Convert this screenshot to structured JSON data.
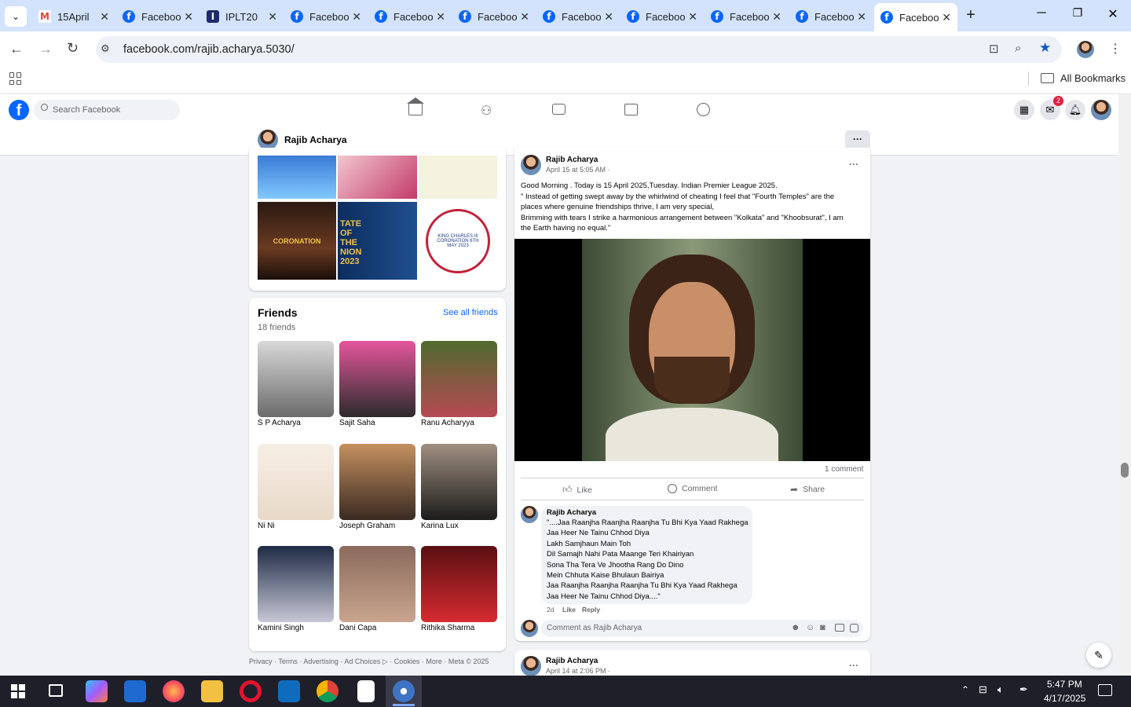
{
  "browser": {
    "tabs": [
      {
        "title": "15April",
        "icon": "gmail-icon"
      },
      {
        "title": "Facebook",
        "icon": "facebook-icon"
      },
      {
        "title": "IPLT20",
        "icon": "iplt20-icon"
      },
      {
        "title": "Facebook",
        "icon": "facebook-icon"
      },
      {
        "title": "Facebook",
        "icon": "facebook-icon"
      },
      {
        "title": "Facebook",
        "icon": "facebook-icon"
      },
      {
        "title": "Facebook",
        "icon": "facebook-icon"
      },
      {
        "title": "Facebook",
        "icon": "facebook-icon"
      },
      {
        "title": "Facebook",
        "icon": "facebook-icon"
      },
      {
        "title": "Facebook",
        "icon": "facebook-icon"
      },
      {
        "title": "Facebook",
        "icon": "facebook-icon",
        "active": true
      }
    ],
    "url": "facebook.com/rajib.acharya.5030/",
    "all_bookmarks": "All Bookmarks"
  },
  "fb": {
    "search_placeholder": "Search Facebook",
    "messenger_badge": "2",
    "profile_name": "Rajib Acharya",
    "more_button": "···"
  },
  "photos": {
    "tiles": [
      "CORONATION",
      "TATE OF THE NION 2023",
      "KING CHARLES III CORONATION 6TH MAY 2023"
    ]
  },
  "friends": {
    "title": "Friends",
    "count": "18 friends",
    "see_all": "See all friends",
    "list": [
      {
        "name": "S P Acharya"
      },
      {
        "name": "Sajit Saha"
      },
      {
        "name": "Ranu Acharyya"
      },
      {
        "name": "Ni Ni"
      },
      {
        "name": "Joseph Graham"
      },
      {
        "name": "Karina Lux"
      },
      {
        "name": "Kamini Singh"
      },
      {
        "name": "Dani Capa"
      },
      {
        "name": "Rithika Sharma"
      }
    ]
  },
  "footer": "Privacy · Terms · Advertising · Ad Choices ▷ · Cookies · More · Meta © 2025",
  "post": {
    "author": "Rajib Acharya",
    "time": "April 15 at 5:05 AM ·",
    "lines": [
      "Good Morning . Today is 15 April 2025,Tuesday. Indian Premier League 2025.",
      "\" Instead of getting swept away by the whirlwind of cheating I feel that \"Fourth Temples\" are the",
      "places where genuine friendships thrive, I am very special,",
      "Brimming with tears I strike a harmonious arrangement between \"Kolkata\" and \"Khoobsurat\", I am",
      "the Earth having no equal.\""
    ],
    "comments_count": "1 comment",
    "like": "Like",
    "comment": "Comment",
    "share": "Share",
    "reply": {
      "author": "Rajib Acharya",
      "lines": [
        "\"....Jaa Raanjha Raanjha Raanjha Tu Bhi Kya Yaad Rakhega",
        "Jaa Heer Ne Tainu Chhod Diya",
        "Lakh Samjhaun Main Toh",
        "Dil Samajh Nahi Pata Maange Teri Khairiyan",
        "Sona Tha Tera Ve Jhootha Rang Do Dino",
        "Mein Chhuta Kaise Bhulaun Bairiya",
        "Jaa Raanjha Raanjha Raanjha Tu Bhi Kya Yaad Rakhega",
        "Jaa Heer Ne Tainu Chhod Diya....\""
      ],
      "age": "2d",
      "like": "Like",
      "reply": "Reply"
    },
    "comment_placeholder": "Comment as Rajib Acharya"
  },
  "post2": {
    "author": "Rajib Acharya",
    "time": "April 14 at 2:06 PM ·"
  },
  "taskbar": {
    "time": "5:47 PM",
    "date": "4/17/2025"
  }
}
